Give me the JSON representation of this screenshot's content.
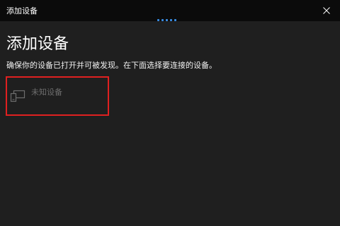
{
  "window": {
    "title": "添加设备",
    "close_icon": "close-icon"
  },
  "main": {
    "title": "添加设备",
    "subtitle": "确保你的设备已打开并可被发现。在下面选择要连接的设备。",
    "devices": [
      {
        "label": "未知设备",
        "icon": "display-device-icon"
      }
    ]
  },
  "colors": {
    "background": "#1f1f1f",
    "titlebar": "#0b0b0b",
    "accent": "#3a8ee6",
    "highlight_border": "#e02020"
  }
}
